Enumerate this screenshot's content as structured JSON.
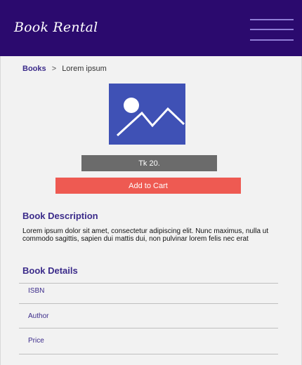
{
  "navbar": {
    "brand": "Book Rental",
    "menu_icon": "hamburger-menu-icon",
    "background": "#2b0a6e"
  },
  "breadcrumb": {
    "parent": "Books",
    "separator": ">",
    "current": "Lorem ipsum"
  },
  "book": {
    "cover_icon": "image-placeholder-icon",
    "cover_color": "#3f51b5",
    "price": "Tk 20.",
    "add_to_cart_label": "Add to Cart",
    "add_to_cart_color": "#ee5a52"
  },
  "description": {
    "title": "Book Description",
    "text": "Lorem ipsum dolor sit amet, consectetur adipiscing elit. Nunc maximus, nulla ut commodo sagittis, sapien dui mattis dui, non pulvinar lorem felis nec erat"
  },
  "details": {
    "title": "Book Details",
    "items": [
      {
        "label": "ISBN"
      },
      {
        "label": "Author"
      },
      {
        "label": "Price"
      }
    ]
  }
}
